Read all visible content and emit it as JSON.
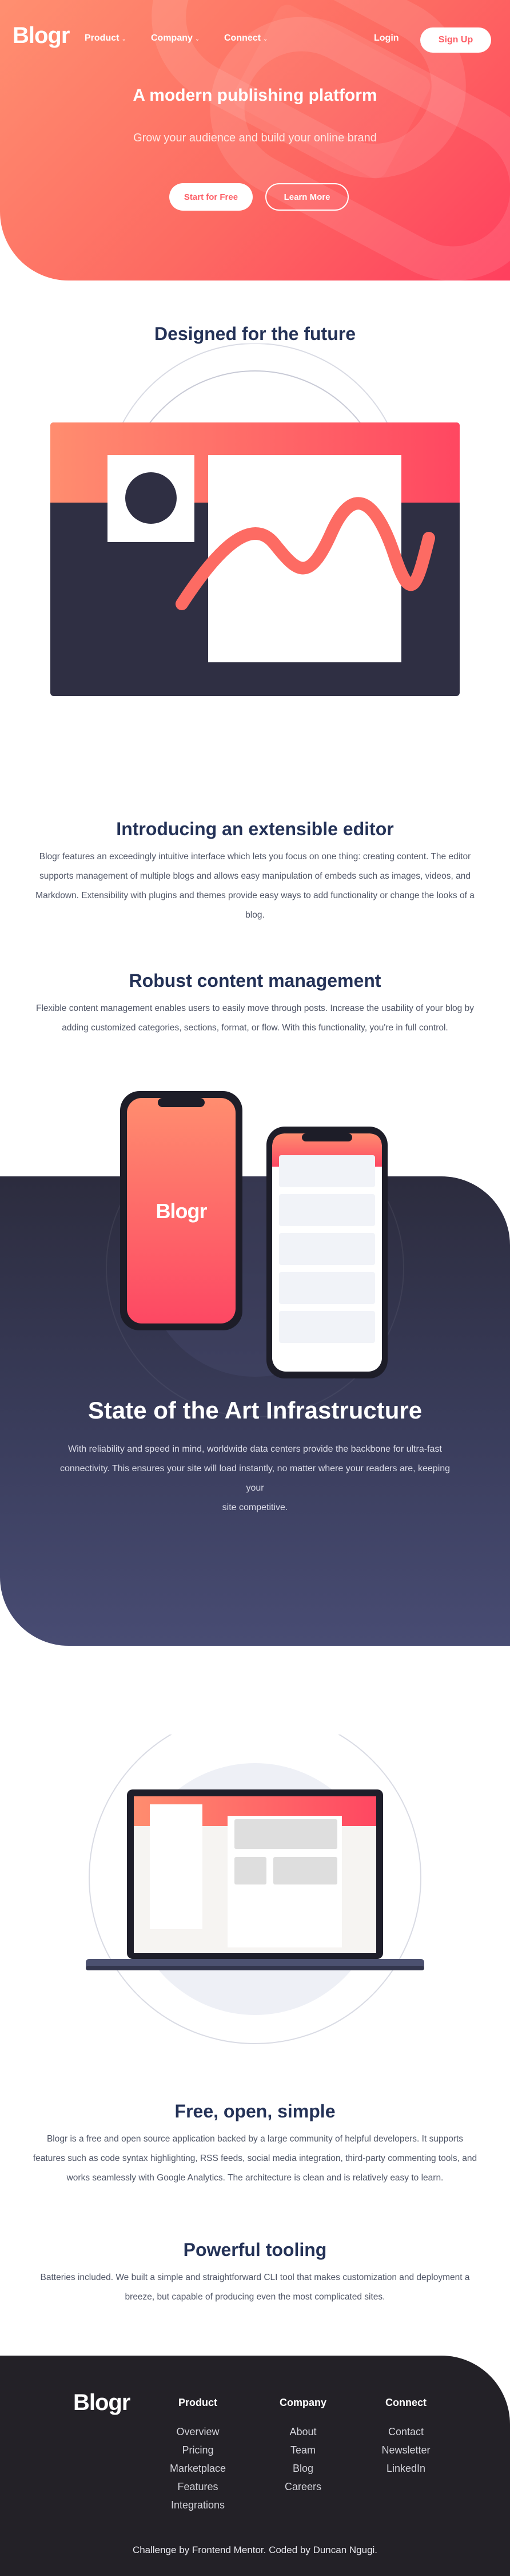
{
  "header": {
    "logo": "Blogr",
    "nav": [
      {
        "label": "Product"
      },
      {
        "label": "Company"
      },
      {
        "label": "Connect"
      }
    ],
    "login_label": "Login",
    "signup_label": "Sign Up"
  },
  "hero": {
    "title": "A modern publishing platform",
    "subtitle": "Grow your audience and build your online brand",
    "primary_cta": "Start for Free",
    "secondary_cta": "Learn More"
  },
  "future": {
    "title": "Designed for the future"
  },
  "editor": {
    "title": "Introducing an extensible editor",
    "lines": [
      "Blogr features an exceedingly intuitive interface which lets you focus on one thing: creating content. The editor",
      "supports management of multiple blogs and allows easy manipulation of embeds such as images, videos, and",
      "Markdown. Extensibility with plugins and themes provide easy ways to add functionality or change the looks of a",
      "blog."
    ]
  },
  "content": {
    "title": "Robust content management",
    "lines": [
      "Flexible content management enables users to easily move through posts. Increase the usability of your blog by",
      "adding customized categories, sections, format, or flow. With this functionality, you're in full control."
    ]
  },
  "phone": {
    "logo": "Blogr"
  },
  "infrastructure": {
    "title": "State of the Art Infrastructure",
    "lines": [
      "With reliability and speed in mind, worldwide data centers provide the backbone for ultra-fast",
      "connectivity. This ensures your site will load instantly, no matter where your readers are, keeping your",
      "site competitive."
    ]
  },
  "free": {
    "title": "Free, open, simple",
    "lines": [
      "Blogr is a free and open source application backed by a large community of helpful developers. It supports",
      "features such as code syntax highlighting, RSS feeds, social media integration, third-party commenting tools, and",
      "works seamlessly with Google Analytics. The architecture is clean and is relatively easy to learn."
    ]
  },
  "tooling": {
    "title": "Powerful tooling",
    "lines": [
      "Batteries included. We built a simple and straightforward CLI tool that makes customization and deployment a",
      "breeze, but capable of producing even the most complicated sites."
    ]
  },
  "footer": {
    "logo": "Blogr",
    "columns": [
      {
        "title": "Product",
        "links": [
          "Overview",
          "Pricing",
          "Marketplace",
          "Features",
          "Integrations"
        ]
      },
      {
        "title": "Company",
        "links": [
          "About",
          "Team",
          "Blog",
          "Careers"
        ]
      },
      {
        "title": "Connect",
        "links": [
          "Contact",
          "Newsletter",
          "LinkedIn"
        ]
      }
    ],
    "attribution": "Challenge by Frontend Mentor. Coded by Duncan Ngugi."
  },
  "colors": {
    "hero_start": "#ff8f70",
    "hero_end": "#ff3f5e",
    "heading": "#243257",
    "dark_band": "#2c2c3e",
    "footer": "#232127"
  }
}
